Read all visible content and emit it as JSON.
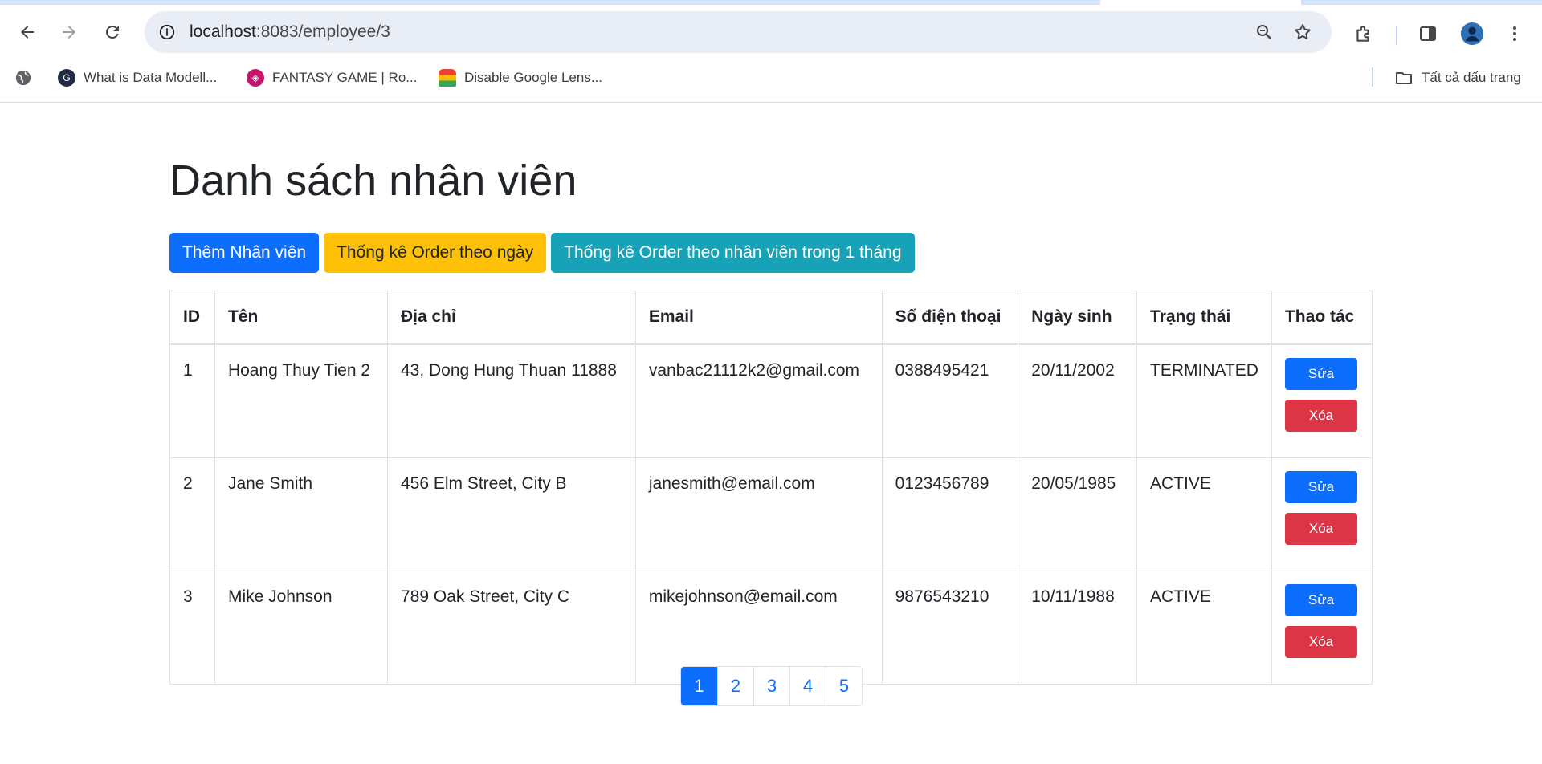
{
  "browser": {
    "url_host": "localhost",
    "url_rest": ":8083/employee/3",
    "bookmarks": [
      {
        "label": "What is Data Modell...",
        "icon": "data-modelling-favicon"
      },
      {
        "label": "FANTASY GAME | Ro...",
        "icon": "fantasy-game-favicon"
      },
      {
        "label": "Disable Google Lens...",
        "icon": "disable-lens-favicon"
      }
    ],
    "all_bookmarks_label": "Tất cả dấu trang"
  },
  "page": {
    "title": "Danh sách nhân viên",
    "buttons": {
      "add_employee": "Thêm Nhân viên",
      "stats_by_day": "Thống kê Order theo ngày",
      "stats_by_employee": "Thống kê Order theo nhân viên trong 1 tháng"
    }
  },
  "table": {
    "headers": [
      "ID",
      "Tên",
      "Địa chỉ",
      "Email",
      "Số điện thoại",
      "Ngày sinh",
      "Trạng thái",
      "Thao tác"
    ],
    "rows": [
      {
        "id": "1",
        "name": "Hoang Thuy Tien 2",
        "address": "43, Dong Hung Thuan 11888",
        "email": "vanbac21112k2@gmail.com",
        "phone": "0388495421",
        "dob": "20/11/2002",
        "status": "TERMINATED"
      },
      {
        "id": "2",
        "name": "Jane Smith",
        "address": "456 Elm Street, City B",
        "email": "janesmith@email.com",
        "phone": "0123456789",
        "dob": "20/05/1985",
        "status": "ACTIVE"
      },
      {
        "id": "3",
        "name": "Mike Johnson",
        "address": "789 Oak Street, City C",
        "email": "mikejohnson@email.com",
        "phone": "9876543210",
        "dob": "10/11/1988",
        "status": "ACTIVE"
      }
    ],
    "edit_label": "Sửa",
    "delete_label": "Xóa"
  },
  "pagination": {
    "pages": [
      "1",
      "2",
      "3",
      "4",
      "5"
    ],
    "active": "1"
  },
  "colors": {
    "primary": "#0d6efd",
    "warning": "#ffc107",
    "info": "#17a2b8",
    "danger": "#dc3545"
  }
}
